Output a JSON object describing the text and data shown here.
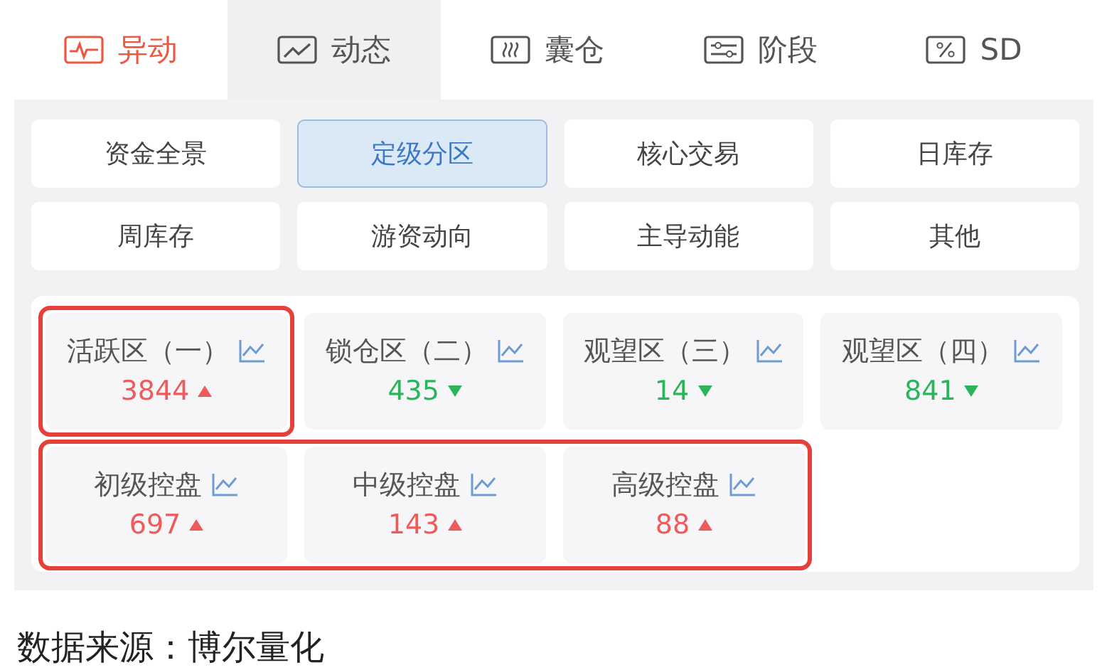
{
  "tabs": [
    {
      "label": "异动",
      "selected": false,
      "alert": true
    },
    {
      "label": "动态",
      "selected": true,
      "alert": false
    },
    {
      "label": "囊仓",
      "selected": false,
      "alert": false
    },
    {
      "label": "阶段",
      "selected": false,
      "alert": false
    },
    {
      "label": "SD",
      "selected": false,
      "alert": false
    }
  ],
  "filters": [
    {
      "label": "资金全景",
      "selected": false
    },
    {
      "label": "定级分区",
      "selected": true
    },
    {
      "label": "核心交易",
      "selected": false
    },
    {
      "label": "日库存",
      "selected": false
    },
    {
      "label": "周库存",
      "selected": false
    },
    {
      "label": "游资动向",
      "selected": false
    },
    {
      "label": "主导动能",
      "selected": false
    },
    {
      "label": "其他",
      "selected": false
    }
  ],
  "card_rows": [
    [
      {
        "label": "活跃区（一）",
        "value": "3844",
        "rising": true,
        "outlined": true
      },
      {
        "label": "锁仓区（二）",
        "value": "435",
        "rising": false,
        "outlined": false
      },
      {
        "label": "观望区（三）",
        "value": "14",
        "rising": false,
        "outlined": false
      },
      {
        "label": "观望区（四）",
        "value": "841",
        "rising": false,
        "outlined": false
      }
    ],
    [
      {
        "label": "初级控盘",
        "value": "697",
        "rising": true,
        "outlined": true
      },
      {
        "label": "中级控盘",
        "value": "143",
        "rising": true,
        "outlined": true
      },
      {
        "label": "高级控盘",
        "value": "88",
        "rising": true,
        "outlined": true
      }
    ]
  ],
  "source_note": "数据来源：博尔量化"
}
